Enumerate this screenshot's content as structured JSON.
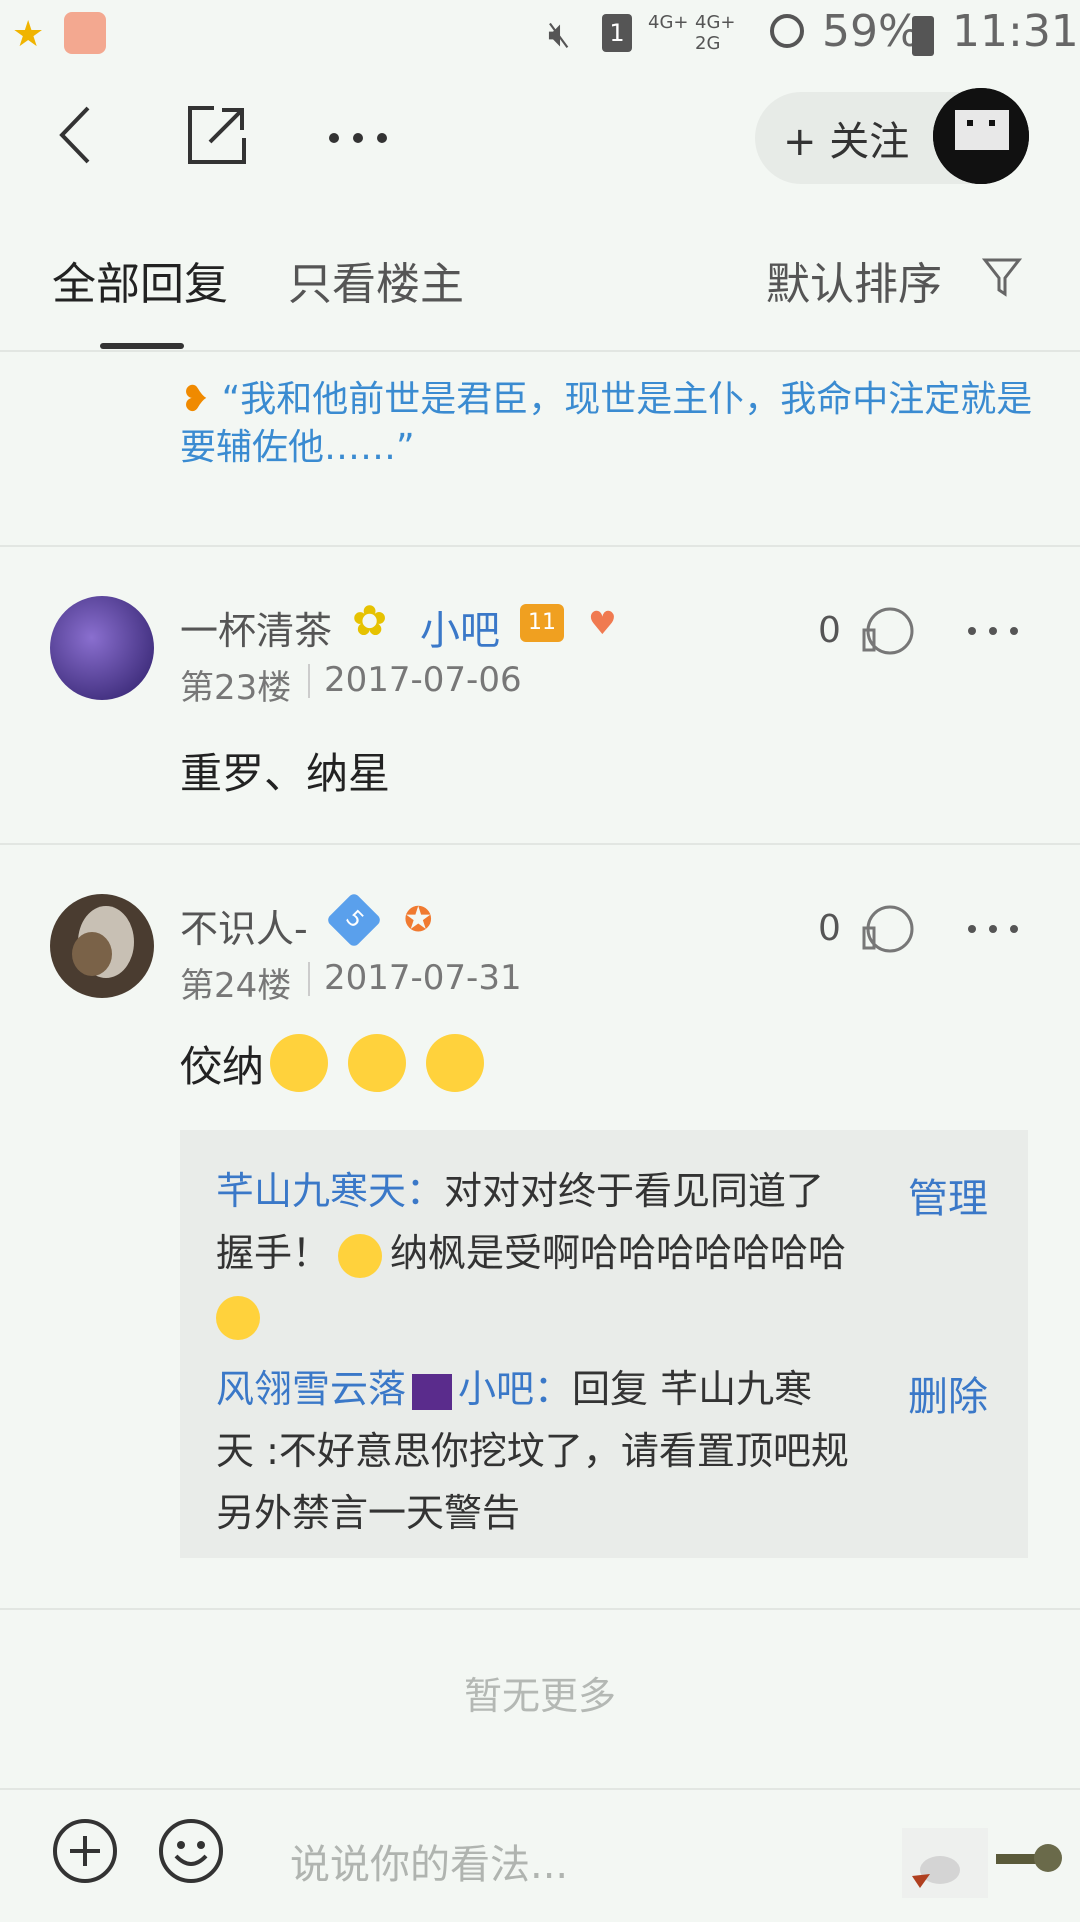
{
  "status_bar": {
    "battery": "59%",
    "time": "11:31",
    "network_labels": [
      "4G+",
      "4G+ 2G"
    ]
  },
  "header": {
    "follow_label": "+ 关注"
  },
  "tabs": {
    "all_replies": "全部回复",
    "op_only": "只看楼主",
    "sort": "默认排序"
  },
  "partial_post": {
    "quote": "“我和他前世是君臣，现世是主仆，我命中注定就是要辅佐他……”"
  },
  "posts": [
    {
      "username": "一杯清茶",
      "role": "小吧",
      "level": "11",
      "floor": "第23楼",
      "date": "2017-07-06",
      "content": "重罗、纳星",
      "likes": "0"
    },
    {
      "username": "不识人-",
      "level": "5",
      "floor": "第24楼",
      "date": "2017-07-31",
      "content": "佼纳",
      "likes": "0"
    }
  ],
  "replies": [
    {
      "name": "芊山九寒天：",
      "text1": "对对对终于看见同道了",
      "text2": "握手！",
      "text3": "纳枫是受啊哈哈哈哈哈哈哈",
      "action": "管理"
    },
    {
      "name": "风翎雪云落",
      "role": "小吧：",
      "text1": "回复 芊山九寒",
      "text2": "天 :不好意思你挖坟了，请看置顶吧规",
      "text3": "另外禁言一天警告",
      "action": "删除"
    }
  ],
  "footer": {
    "no_more": "暂无更多",
    "input_placeholder": "说说你的看法..."
  },
  "colors": {
    "accent_blue": "#3a78c8",
    "quote_blue": "#3a8bd1",
    "background": "#f3f7f3"
  }
}
